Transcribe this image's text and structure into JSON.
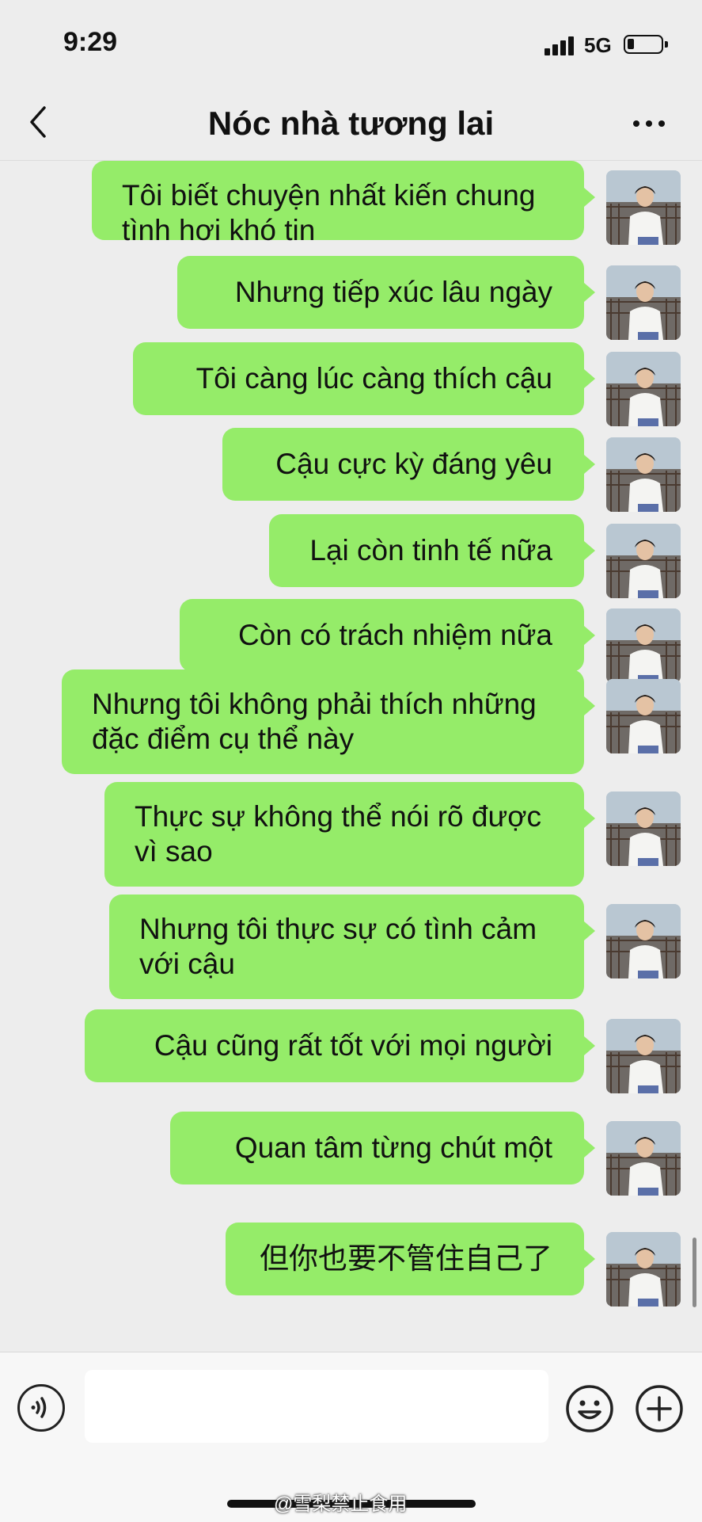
{
  "status_bar": {
    "time": "9:29",
    "network": "5G"
  },
  "header": {
    "title": "Nóc nhà tương lai"
  },
  "messages": [
    {
      "lines": [
        "Tôi biết chuyện nhất kiến chung",
        "tình hơi khó tin"
      ]
    },
    {
      "lines": [
        "Nhưng tiếp xúc lâu ngày"
      ]
    },
    {
      "lines": [
        "Tôi càng lúc càng thích cậu"
      ]
    },
    {
      "lines": [
        "Cậu cực kỳ đáng yêu"
      ]
    },
    {
      "lines": [
        "Lại còn tinh tế nữa"
      ]
    },
    {
      "lines": [
        "Còn có trách nhiệm nữa"
      ]
    },
    {
      "lines": [
        "Nhưng tôi không phải thích những",
        "đặc điểm cụ thể này"
      ]
    },
    {
      "lines": [
        "Thực sự không thể nói rõ được",
        "vì sao"
      ]
    },
    {
      "lines": [
        "Nhưng tôi thực sự có tình cảm",
        "với cậu"
      ]
    },
    {
      "lines": [
        "Cậu cũng rất tốt với mọi người"
      ]
    },
    {
      "lines": [
        "Quan tâm từng chút một"
      ]
    },
    {
      "lines": [
        "但你也要不管住自己了"
      ]
    }
  ],
  "input": {
    "placeholder": ""
  },
  "watermark": "@雪梨禁止食用",
  "colors": {
    "bubble": "#95ec69",
    "background": "#ededed"
  },
  "icons": {
    "back": "chevron-left-icon",
    "more": "more-dots-icon",
    "voice": "voice-icon",
    "emoji": "emoji-icon",
    "plus": "plus-icon"
  }
}
